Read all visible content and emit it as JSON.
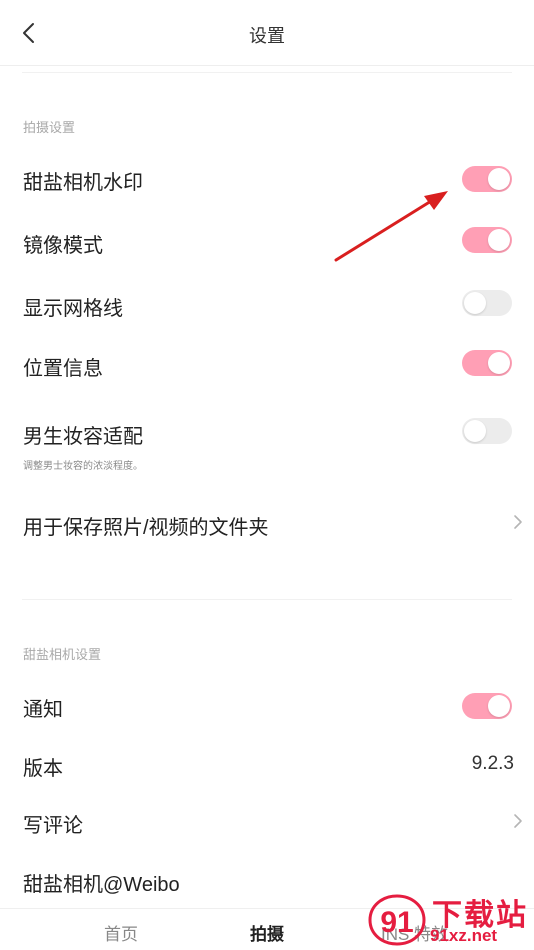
{
  "header": {
    "title": "设置"
  },
  "shooting": {
    "section_label": "拍摄设置",
    "items": [
      {
        "label": "甜盐相机水印",
        "state": "on"
      },
      {
        "label": "镜像模式",
        "state": "on"
      },
      {
        "label": "显示网格线",
        "state": "off"
      },
      {
        "label": "位置信息",
        "state": "on"
      },
      {
        "label": "男生妆容适配",
        "state": "off",
        "description": "调整男士妆容的浓淡程度。"
      },
      {
        "label": "用于保存照片/视频的文件夹",
        "icon": "chevron-right-icon"
      }
    ]
  },
  "app_settings": {
    "section_label": "甜盐相机设置",
    "items": [
      {
        "label": "通知",
        "state": "on"
      },
      {
        "label": "版本",
        "value": "9.2.3"
      },
      {
        "label": "写评论",
        "icon": "chevron-right-icon"
      },
      {
        "label": "甜盐相机@Weibo"
      }
    ]
  },
  "tabbar": {
    "tabs": [
      {
        "label": "首页"
      },
      {
        "label": "拍摄",
        "active": true
      },
      {
        "label": "INS 特效"
      }
    ]
  },
  "watermark": {
    "badge": "91",
    "title": "下载站",
    "url": "91xz.net"
  },
  "colors": {
    "toggle_on": "#ff9fb5",
    "toggle_off": "#ececec",
    "annotation_arrow": "#e02020",
    "watermark": "#e51d40"
  }
}
